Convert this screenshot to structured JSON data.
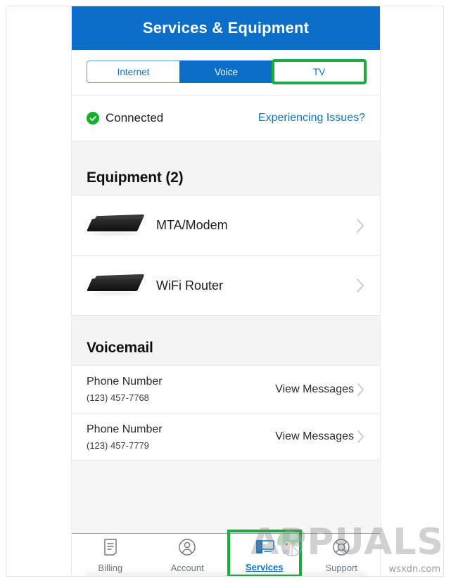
{
  "header": {
    "title": "Services & Equipment",
    "background_color": "#0b6fc9"
  },
  "tabs": {
    "items": [
      {
        "label": "Internet",
        "selected": false,
        "annotated": false
      },
      {
        "label": "Voice",
        "selected": true,
        "annotated": false
      },
      {
        "label": "TV",
        "selected": false,
        "annotated": true
      }
    ],
    "annotation_color": "#19ab3c"
  },
  "status": {
    "icon": "check-circle-icon",
    "label": "Connected",
    "status_color": "#14b028",
    "link_label": "Experiencing Issues?",
    "link_color": "#1172c4"
  },
  "equipment": {
    "heading": "Equipment (2)",
    "items": [
      {
        "name": "MTA/Modem",
        "icon": "modem-device-image",
        "chevron": "chevron-right-icon"
      },
      {
        "name": "WiFi Router",
        "icon": "router-device-image",
        "chevron": "chevron-right-icon"
      }
    ]
  },
  "voicemail": {
    "heading": "Voicemail",
    "items": [
      {
        "title": "Phone Number",
        "number": "(123) 457-7768",
        "action_label": "View Messages"
      },
      {
        "title": "Phone Number",
        "number": "(123) 457-7779",
        "action_label": "View Messages"
      }
    ]
  },
  "bottom_nav": {
    "items": [
      {
        "label": "Billing",
        "icon": "invoice-icon",
        "active": false,
        "annotated": false
      },
      {
        "label": "Account",
        "icon": "person-circle-icon",
        "active": false,
        "annotated": false
      },
      {
        "label": "Services",
        "icon": "devices-icon",
        "active": true,
        "annotated": true
      },
      {
        "label": "Support",
        "icon": "lifebuoy-icon",
        "active": false,
        "annotated": false
      }
    ],
    "active_color": "#1172c4",
    "inactive_color": "#6d7680"
  },
  "watermark": {
    "text": "APPUALS",
    "corner_text": "wsxdn.com"
  }
}
